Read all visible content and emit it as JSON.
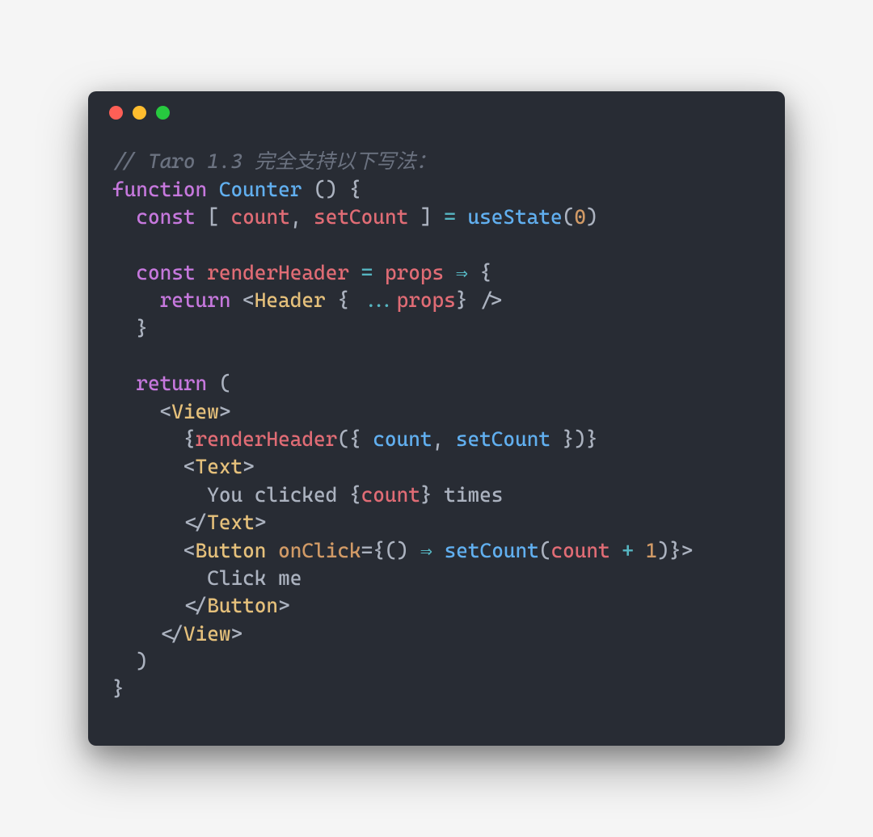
{
  "colors": {
    "background": "#282c34",
    "comment": "#6b7280",
    "keyword": "#c678dd",
    "function": "#61afef",
    "variable": "#e06c75",
    "punctuation": "#abb2bf",
    "operator": "#56b6c2",
    "number": "#d19a66",
    "tag": "#e5c07b",
    "attr": "#d19a66",
    "text": "#abb2bf",
    "dot_red": "#ff5f56",
    "dot_yellow": "#ffbd2e",
    "dot_green": "#27c93f"
  },
  "code": {
    "line1_comment": "// Taro 1.3 完全支持以下写法：",
    "line2": {
      "kw_function": "function",
      "fn_name": "Counter",
      "parens_brace": " () {"
    },
    "line3": {
      "kw_const": "const",
      "br_open": " [ ",
      "var_count": "count",
      "comma": ", ",
      "var_setcount": "setCount",
      "br_close": " ] ",
      "eq": "= ",
      "fn_usestate": "useState",
      "paren_open": "(",
      "num_zero": "0",
      "paren_close": ")"
    },
    "line5": {
      "kw_const": "const",
      "var_rh": "renderHeader",
      "eq": " = ",
      "var_props": "props",
      "arrow": " ⇒ ",
      "brace": "{"
    },
    "line6": {
      "kw_return": "return",
      "lt": " <",
      "tag_header": "Header",
      "sp_brace": " { ",
      "spread": "...",
      "var_props": "props",
      "close": "} />"
    },
    "line7_brace": "  }",
    "line9": {
      "kw_return": "return",
      "paren": " ("
    },
    "line10": {
      "lt": "<",
      "tag": "View",
      "gt": ">"
    },
    "line11": {
      "open": "{",
      "fn_rh": "renderHeader",
      "p_open": "({ ",
      "var_count": "count",
      "comma": ", ",
      "var_setcount": "setCount",
      "p_close": " })}"
    },
    "line12": {
      "lt": "<",
      "tag": "Text",
      "gt": ">"
    },
    "line13": {
      "txt1": "You clicked {",
      "var_count": "count",
      "txt2": "} times"
    },
    "line14": {
      "lt": "</",
      "tag": "Text",
      "gt": ">"
    },
    "line15": {
      "lt": "<",
      "tag": "Button",
      "sp": " ",
      "attr": "onClick",
      "eq_brace": "={() ",
      "arrow": "⇒",
      "sp2": " ",
      "fn_setcount": "setCount",
      "p_open": "(",
      "var_count": "count",
      "plus": " + ",
      "num_one": "1",
      "p_close": ")}>",
      "gt": ""
    },
    "line16_txt": "Click me",
    "line17": {
      "lt": "</",
      "tag": "Button",
      "gt": ">"
    },
    "line18": {
      "lt": "</",
      "tag": "View",
      "gt": ">"
    },
    "line19_paren": "  )",
    "line20_brace": "}"
  }
}
